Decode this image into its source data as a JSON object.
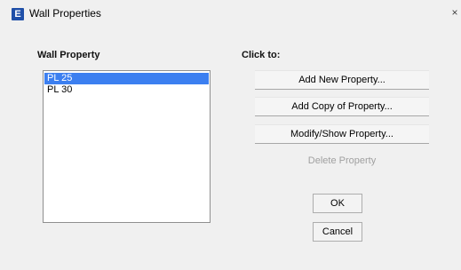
{
  "window": {
    "title": "Wall Properties",
    "app_icon_letter": "E",
    "close_glyph": "×"
  },
  "wall_property": {
    "label": "Wall Property",
    "items": [
      "PL 25",
      "PL 30"
    ],
    "selected": "PL 25"
  },
  "actions": {
    "label": "Click to:",
    "add_new": "Add New Property...",
    "add_copy": "Add Copy of Property...",
    "modify_show": "Modify/Show Property...",
    "delete": "Delete Property"
  },
  "footer": {
    "ok": "OK",
    "cancel": "Cancel"
  },
  "colors": {
    "selection": "#3c7ff0",
    "app_icon": "#1f4fa8"
  }
}
